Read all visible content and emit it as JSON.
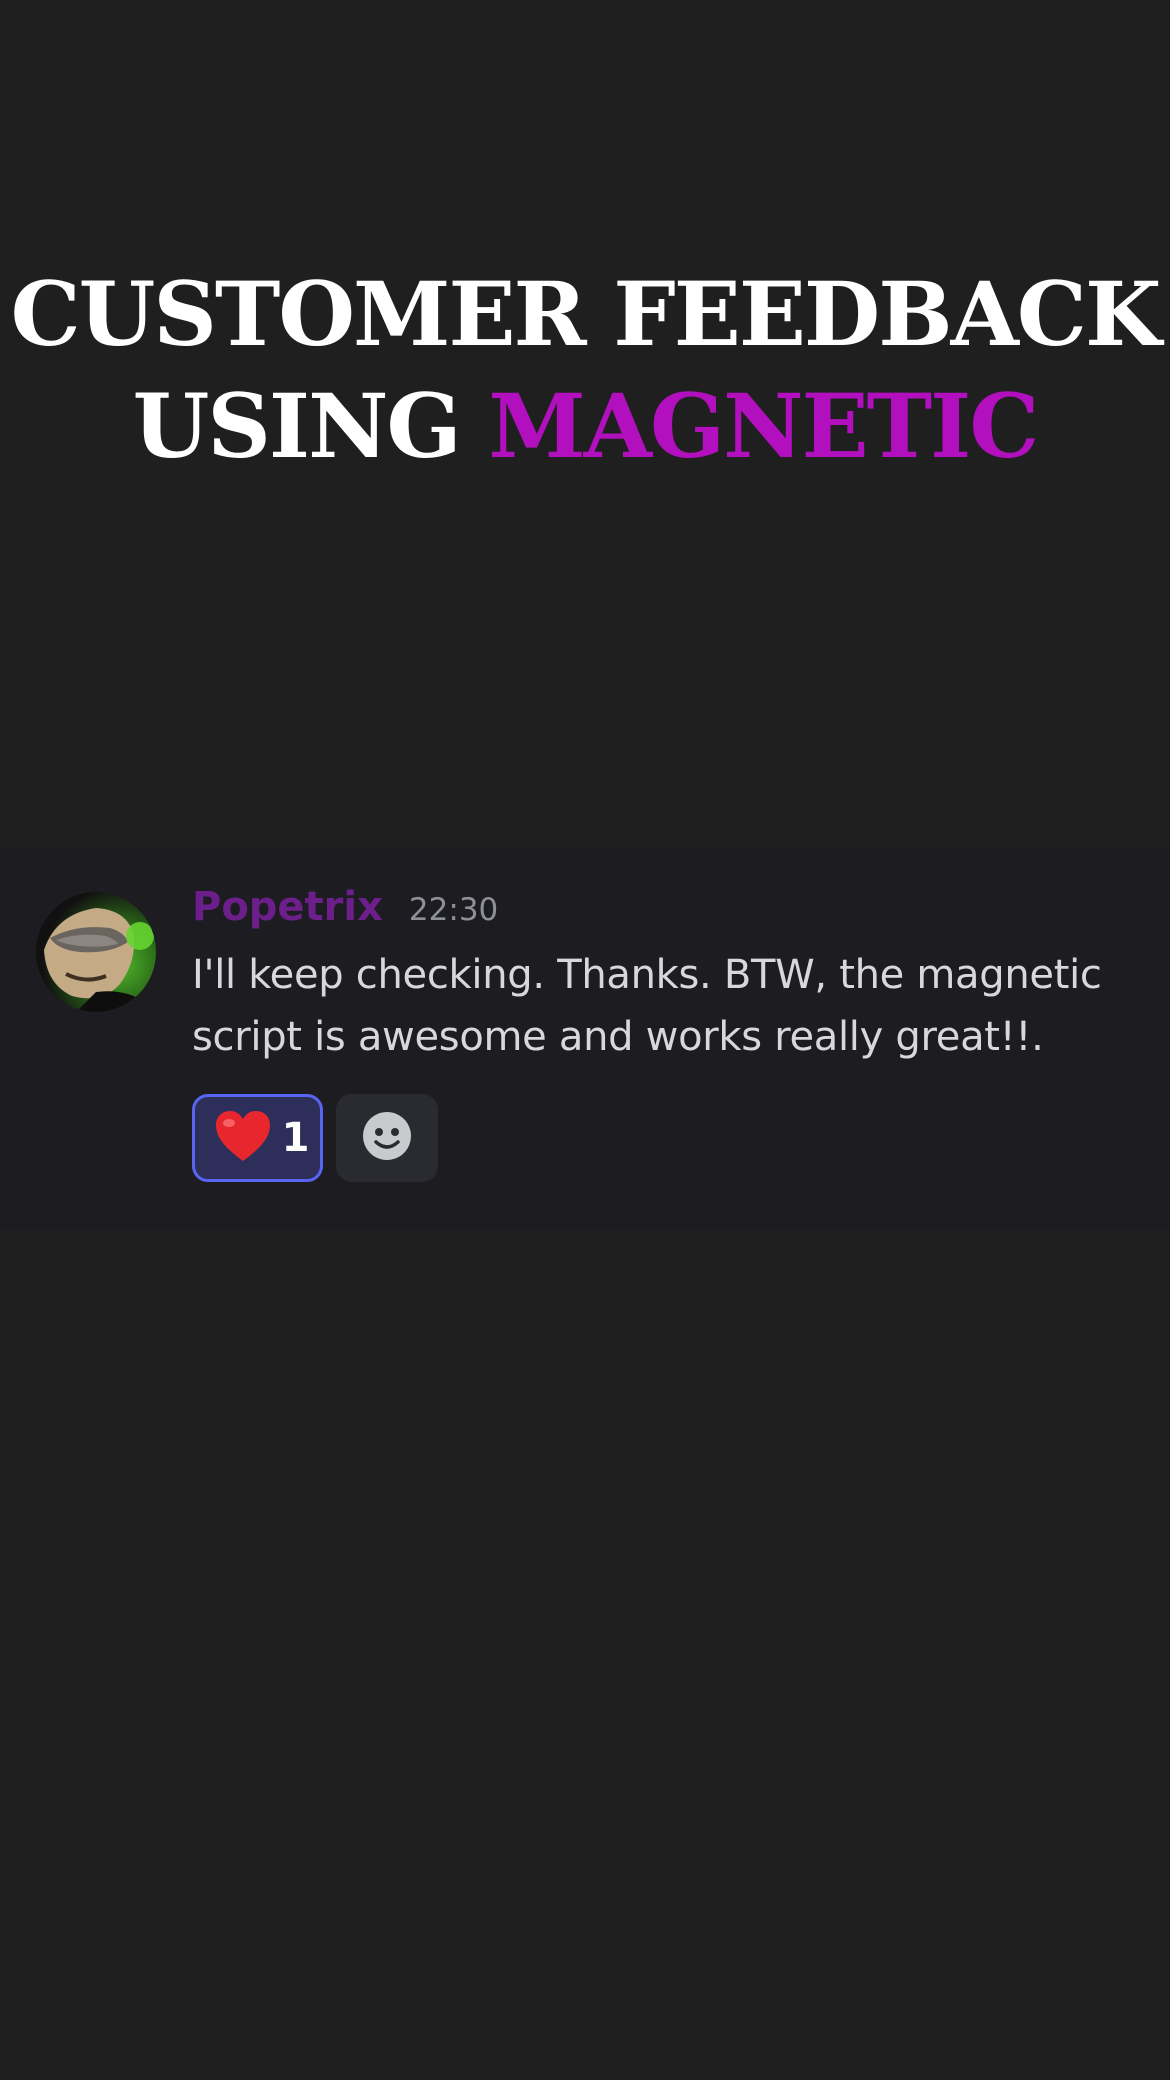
{
  "headline": {
    "line1": "CUSTOMER FEEDBACK",
    "line2_prefix": "USING",
    "line2_accent": "MAGNETIC",
    "accent_color": "#b20fbf"
  },
  "message": {
    "username": "Popetrix",
    "username_color": "#6c1f8a",
    "timestamp": "22:30",
    "text": "I'll keep checking. Thanks. BTW, the magnetic script is awesome and works really great!!.",
    "avatar_icon": "user-avatar-icon",
    "reactions": [
      {
        "emoji_icon": "heart-icon",
        "count": "1",
        "selected": true
      },
      {
        "emoji_icon": "add-reaction-icon"
      }
    ]
  }
}
